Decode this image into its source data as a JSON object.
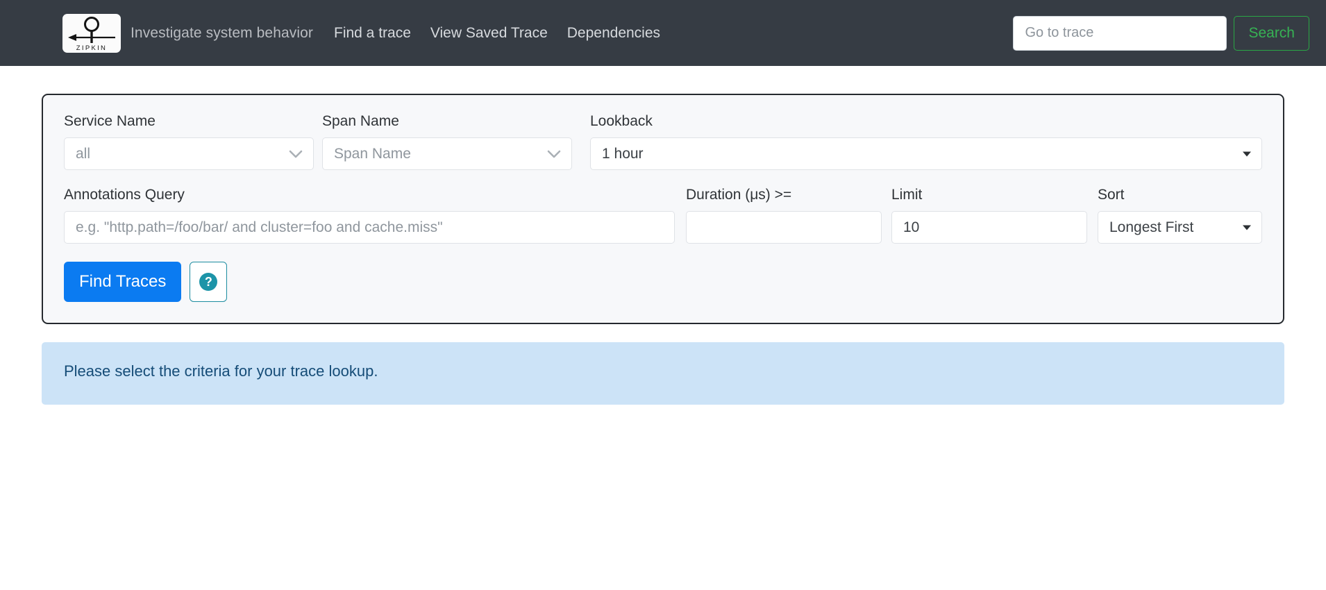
{
  "header": {
    "logo_alt": "ZIPKIN",
    "logo_text": "ZIPKIN",
    "tagline": "Investigate system behavior",
    "nav": [
      {
        "label": "Find a trace"
      },
      {
        "label": "View Saved Trace"
      },
      {
        "label": "Dependencies"
      }
    ],
    "trace_search": {
      "placeholder": "Go to trace",
      "value": "",
      "button_label": "Search"
    },
    "colors": {
      "bar_background": "#363c44",
      "search_button_border": "#2aa745",
      "search_button_text": "#37b254"
    }
  },
  "search_form": {
    "service_name": {
      "label": "Service Name",
      "value": "all",
      "icon": "chevron-down-icon"
    },
    "span_name": {
      "label": "Span Name",
      "value": "",
      "placeholder": "Span Name",
      "icon": "chevron-down-icon"
    },
    "lookback": {
      "label": "Lookback",
      "value": "1 hour",
      "icon": "caret-down-icon"
    },
    "annotations_query": {
      "label": "Annotations Query",
      "value": "",
      "placeholder": "e.g. \"http.path=/foo/bar/ and cluster=foo and cache.miss\""
    },
    "duration": {
      "label": "Duration (μs) >=",
      "value": "",
      "placeholder": ""
    },
    "limit": {
      "label": "Limit",
      "value": "10",
      "placeholder": ""
    },
    "sort": {
      "label": "Sort",
      "value": "Longest First",
      "icon": "caret-down-icon"
    },
    "find_traces_button": "Find Traces",
    "help_button": {
      "icon": "question-mark-icon",
      "glyph": "?"
    },
    "colors": {
      "card_border": "#25292e",
      "card_background": "#f7f8fa",
      "primary_button": "#0b7bf1",
      "help_accent": "#1c94a8"
    }
  },
  "info_banner": {
    "message": "Please select the criteria for your trace lookup.",
    "background": "#cce3f7",
    "text_color": "#154c77"
  }
}
